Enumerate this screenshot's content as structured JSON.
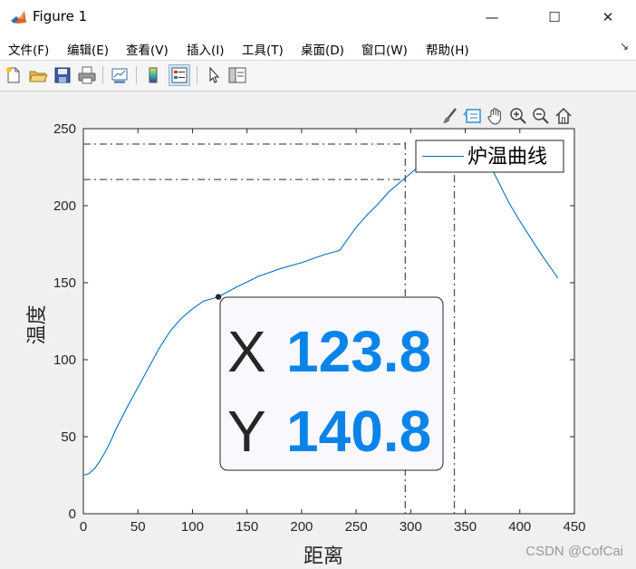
{
  "window": {
    "title": "Figure 1",
    "minimize_glyph": "—",
    "maximize_glyph": "☐",
    "close_glyph": "✕"
  },
  "menu": [
    "文件(F)",
    "编辑(E)",
    "查看(V)",
    "插入(I)",
    "工具(T)",
    "桌面(D)",
    "窗口(W)",
    "帮助(H)"
  ],
  "menu_corner_glyph": "↘",
  "toolbar_icons": [
    "new-figure-icon",
    "open-file-icon",
    "save-icon",
    "print-icon",
    "link-plot-icon",
    "colorbar-icon",
    "legend-icon",
    "pointer-icon",
    "property-editor-icon"
  ],
  "axes_toolbar_icons": [
    "brush-icon",
    "datatip-icon",
    "pan-icon",
    "zoom-in-icon",
    "zoom-out-icon",
    "home-icon"
  ],
  "watermark": "CSDN @CofCai",
  "chart_data": {
    "type": "line",
    "xlabel": "距离",
    "ylabel": "温度",
    "xlim": [
      0,
      450
    ],
    "ylim": [
      0,
      250
    ],
    "xticks": [
      "0",
      "50",
      "100",
      "150",
      "200",
      "250",
      "300",
      "350",
      "400",
      "450"
    ],
    "yticks": [
      "0",
      "50",
      "100",
      "150",
      "200",
      "250"
    ],
    "grid": false,
    "legend_position": "top-right",
    "series": [
      {
        "name": "炉温曲线",
        "color": "#0072bd",
        "x": [
          0,
          5,
          10,
          15,
          20,
          25,
          30,
          40,
          50,
          60,
          70,
          80,
          90,
          100,
          110,
          123.8,
          140,
          160,
          180,
          200,
          220,
          235,
          240,
          250,
          260,
          270,
          280,
          290,
          300,
          310,
          320,
          330,
          340,
          350,
          360,
          370,
          380,
          390,
          400,
          410,
          420,
          435
        ],
        "y": [
          25,
          26,
          29,
          34,
          40,
          47,
          55,
          69,
          82,
          95,
          108,
          119,
          127,
          133,
          138,
          140.8,
          147,
          154,
          159,
          163,
          168,
          171,
          176,
          186,
          194,
          201,
          209,
          215,
          221,
          227,
          231,
          235,
          238,
          239,
          238,
          230,
          216,
          202,
          190,
          179,
          168,
          153
        ]
      }
    ],
    "reference_lines": {
      "horizontal": [
        240,
        217
      ],
      "vertical": [
        295,
        340
      ],
      "style": "dash-dot",
      "color": "#555555"
    },
    "datatip": {
      "x": 123.8,
      "y": 140.8,
      "x_label": "X",
      "y_label": "Y",
      "x_value": "123.8",
      "y_value": "140.8",
      "value_color": "#0a84e8"
    }
  }
}
